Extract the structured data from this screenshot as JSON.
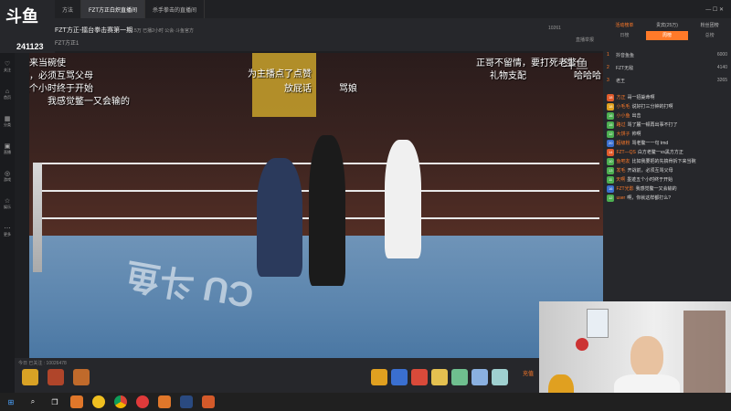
{
  "browser": {
    "tabs": [
      {
        "label": "方法"
      },
      {
        "label": "FZT方正白炽直播间"
      },
      {
        "label": "杀手拳击的直播间"
      }
    ]
  },
  "header": {
    "logo": "斗鱼",
    "viewer_count": "241123",
    "room_title": "FZT方正-擂台拳击赛第一期",
    "room_meta": "22.5万  已播2小时  公会·斗鱼官方",
    "anchor_name": "FZT方正1",
    "room_id": "10261",
    "report_label": "直播举报"
  },
  "left_rail": {
    "items": [
      {
        "label": "关注",
        "icon": "heart-icon"
      },
      {
        "label": "首页",
        "icon": "home-icon"
      },
      {
        "label": "分类",
        "icon": "grid-icon"
      },
      {
        "label": "直播",
        "icon": "tv-icon"
      },
      {
        "label": "游戏",
        "icon": "game-icon"
      },
      {
        "label": "娱乐",
        "icon": "star-icon"
      },
      {
        "label": "更多",
        "icon": "more-icon"
      }
    ]
  },
  "video": {
    "overlay_lines": [
      "骨拆下来当碗使",
      "年战前，必须互骂父母",
      "墨迹五个小时终于开始",
      "我感觉鳖一又会输的"
    ],
    "top_caption": "为主播点了点赞",
    "mid_caption": "放屁话",
    "mid_caption2": "骂娘",
    "right_caption": "正哥不留情，要打死老鳖一",
    "right_caption2": "礼物支配",
    "right_caption3": "哈哈哈",
    "ring_logo": "CU 斗鱼",
    "watermark": "斗鱼"
  },
  "underbar": {
    "room_stats": "今日 已关注 : 10026478",
    "gifts": [
      "gift-1",
      "gift-2",
      "gift-3",
      "gift-4",
      "gift-5",
      "gift-6",
      "gift-7"
    ],
    "recharge_label": "充值"
  },
  "right_panel": {
    "tabs": [
      {
        "label": "活动榜单"
      },
      {
        "label": "贵宾(25万)"
      },
      {
        "label": "粉丝团榜"
      }
    ],
    "subtabs": [
      {
        "label": "日榜"
      },
      {
        "label": "周榜"
      },
      {
        "label": "总榜"
      }
    ],
    "ranking": [
      {
        "rank": "1",
        "name": "抖音鱼鱼",
        "score": "6000"
      },
      {
        "rank": "2",
        "name": "FZT无敌",
        "score": "4140"
      },
      {
        "rank": "3",
        "name": "老王",
        "score": "3265"
      }
    ],
    "chat": [
      {
        "badge": "18",
        "nick": "方正",
        "text": "哥一招毙命啊"
      },
      {
        "badge": "18",
        "nick": "小毛毛",
        "text": "说好打三分钟的打啊"
      },
      {
        "badge": "16",
        "nick": "小小鱼",
        "text": "出击"
      },
      {
        "badge": "15",
        "nick": "路过",
        "text": "骂了麓一顿再出事不打了"
      },
      {
        "badge": "12",
        "nick": "大饼子",
        "text": "帅啊"
      },
      {
        "badge": "20",
        "nick": "超级粉",
        "text": "骂老鳖一一句 tmd"
      },
      {
        "badge": "14",
        "nick": "FZT—QS",
        "text": "白方老鳖一vs黑方方正"
      },
      {
        "badge": "10",
        "nick": "鱼吧友",
        "text": "比如我要把的先搞骨拆下来当碗"
      },
      {
        "badge": "13",
        "nick": "发毛",
        "text": "开战前，必须互骂父母"
      },
      {
        "badge": "11",
        "nick": "天啊",
        "text": "墨迹五个小时终于开始"
      },
      {
        "badge": "16",
        "nick": "FZT光影",
        "text": "我感觉鳖一又会输的"
      },
      {
        "badge": "12",
        "nick": "user",
        "text": "啊，你就这样都打么?"
      }
    ]
  },
  "taskbar": {
    "icons": [
      "windows-icon",
      "search-icon",
      "taskview-icon",
      "app-1",
      "app-2",
      "chrome-icon",
      "app-3",
      "app-4",
      "app-5",
      "app-6"
    ]
  }
}
